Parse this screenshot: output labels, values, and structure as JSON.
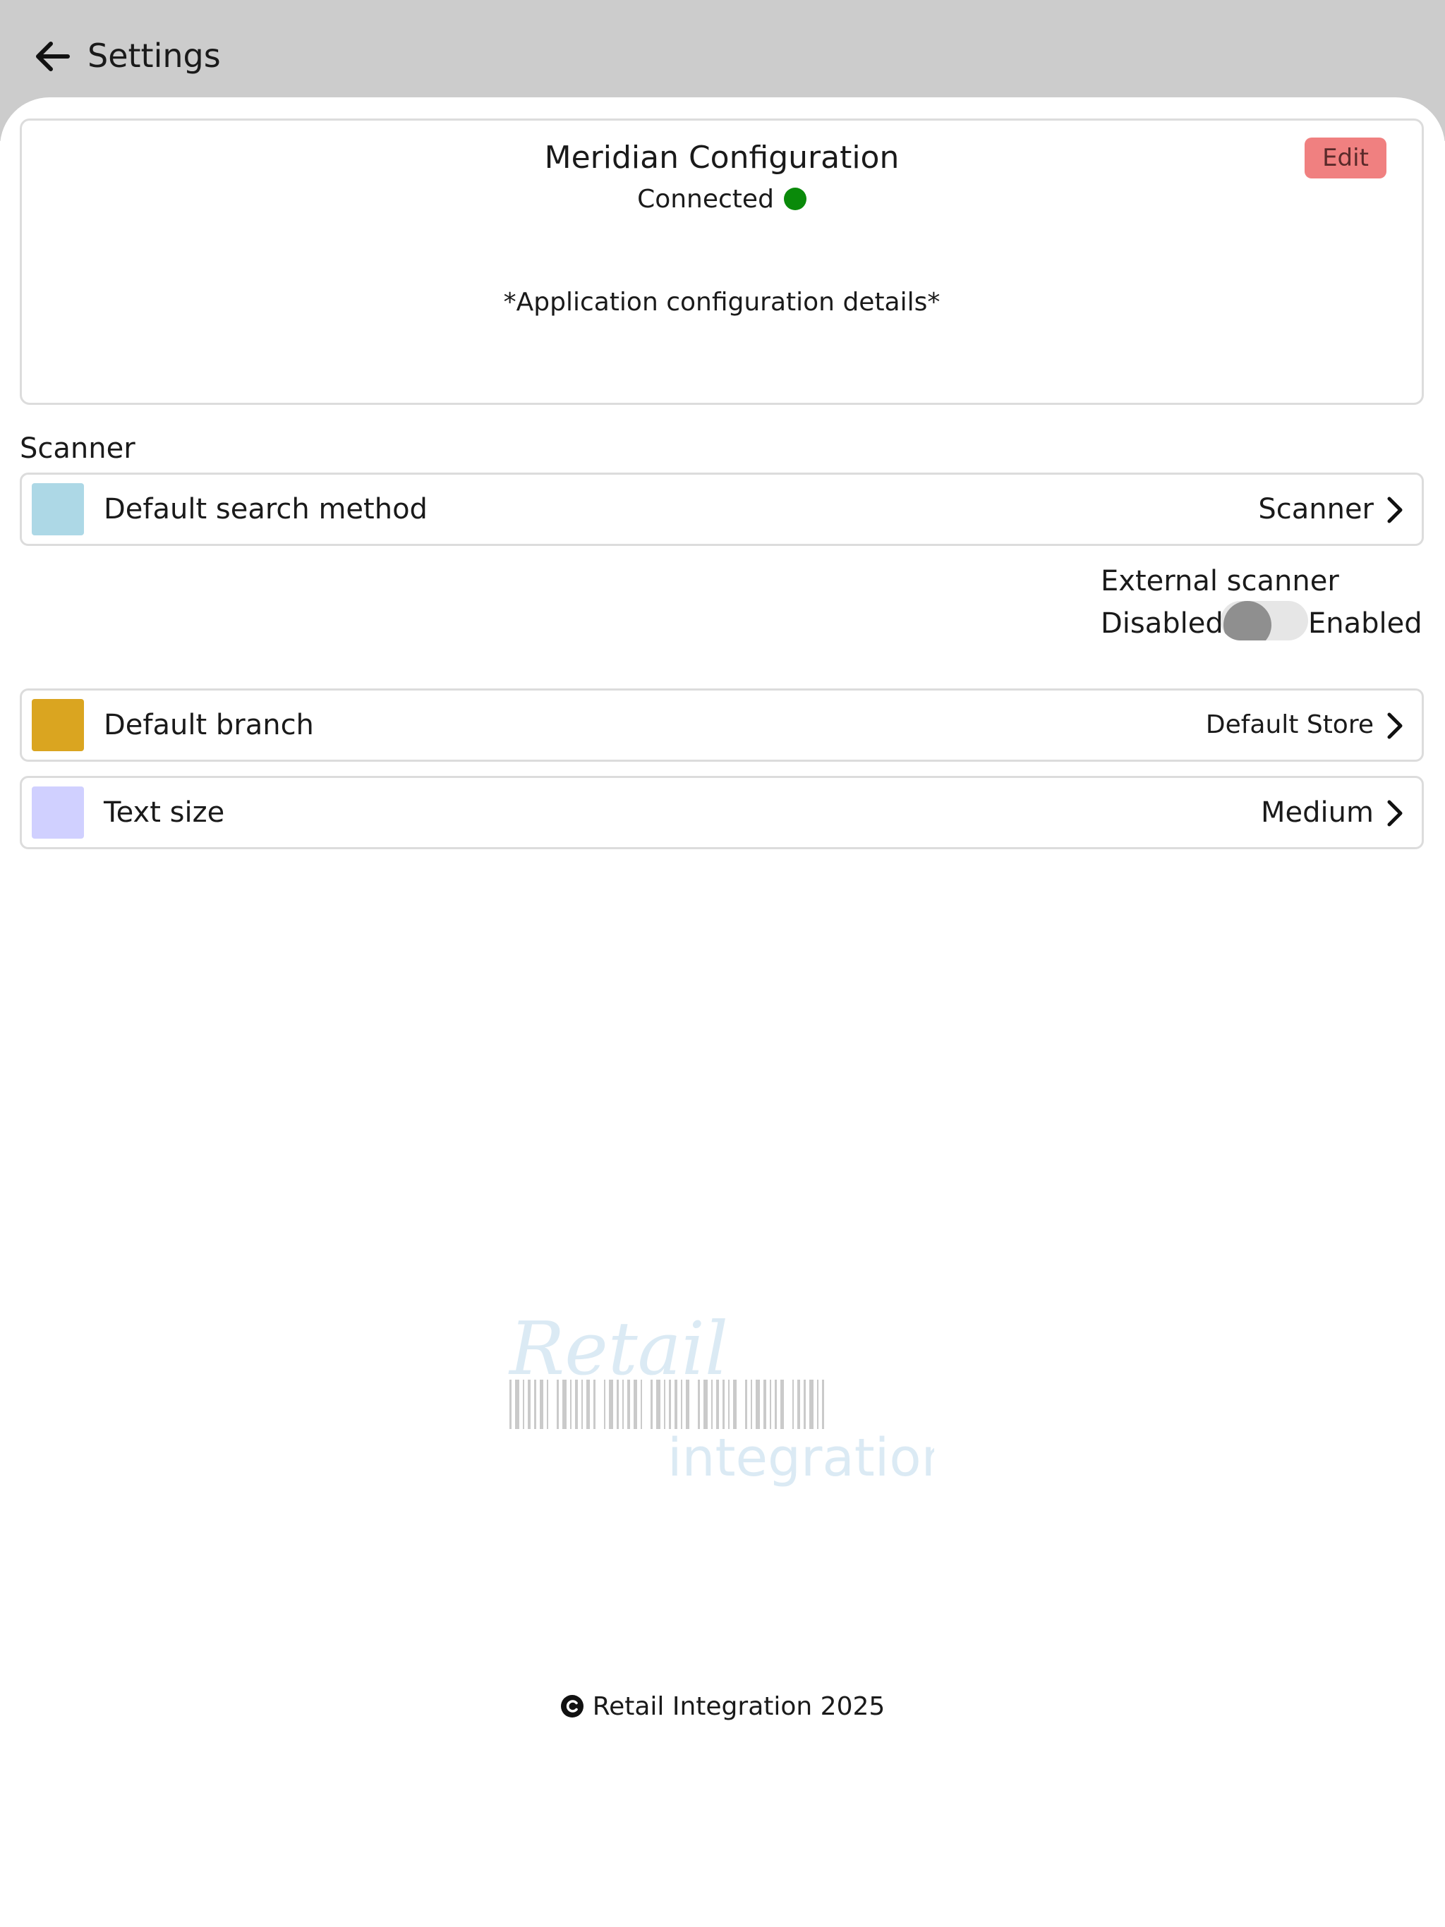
{
  "header": {
    "title": "Settings",
    "back_icon": "arrow-left-icon"
  },
  "config_card": {
    "title": "Meridian Configuration",
    "status_text": "Connected",
    "status_color": "#0a8a0a",
    "edit_label": "Edit",
    "edit_color": "#f08080",
    "details": "*Application configuration details*"
  },
  "scanner_section": {
    "label": "Scanner"
  },
  "rows": [
    {
      "label": "Default search method",
      "value": "Scanner",
      "swatch_color": "#add8e6",
      "icon": "chevron-right-icon"
    },
    {
      "label": "Default branch",
      "value": "Default Store",
      "swatch_color": "#daa520",
      "icon": "chevron-right-icon"
    },
    {
      "label": "Text size",
      "value": "Medium",
      "swatch_color": "#d0d0ff",
      "icon": "chevron-right-icon"
    }
  ],
  "external_scanner": {
    "title": "External scanner",
    "off_label": "Disabled",
    "on_label": "Enabled",
    "enabled": false
  },
  "logo": {
    "word_top": "Retail",
    "word_bottom": "integration",
    "color": "#7fb6d8"
  },
  "footer": {
    "text": "Retail Integration 2025",
    "icon": "copyright-icon"
  }
}
